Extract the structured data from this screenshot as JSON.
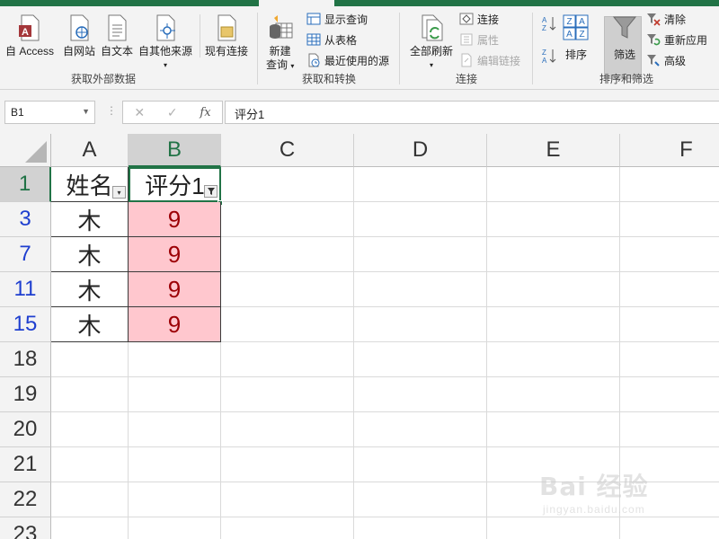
{
  "ribbon": {
    "groups": {
      "external": {
        "label": "获取外部数据",
        "buttons": [
          "自 Access",
          "自网站",
          "自文本",
          "自其他来源",
          "现有连接"
        ]
      },
      "transform": {
        "label": "获取和转换",
        "new_query": "新建",
        "new_query_sub": "查询",
        "show_query": "显示查询",
        "from_table": "从表格",
        "recent_sources": "最近使用的源"
      },
      "connections": {
        "label": "连接",
        "refresh_all": "全部刷新",
        "connections": "连接",
        "properties": "属性",
        "edit_links": "编辑链接"
      },
      "sort_filter": {
        "label": "排序和筛选",
        "sort": "排序",
        "filter": "筛选",
        "clear": "清除",
        "reapply": "重新应用",
        "advanced": "高级"
      }
    }
  },
  "formula_bar": {
    "name_box": "B1",
    "dots": "⋮",
    "cancel": "✕",
    "enter": "✓",
    "fx": "fx",
    "content": "评分1"
  },
  "grid": {
    "columns": [
      "A",
      "B",
      "C",
      "D",
      "E",
      "F"
    ],
    "rows": [
      "1",
      "3",
      "7",
      "11",
      "15",
      "18",
      "19",
      "20",
      "21",
      "22",
      "23"
    ],
    "header": {
      "a": "姓名",
      "b": "评分1"
    },
    "data": [
      {
        "a": "木",
        "b": "9"
      },
      {
        "a": "木",
        "b": "9"
      },
      {
        "a": "木",
        "b": "9"
      },
      {
        "a": "木",
        "b": "9"
      }
    ]
  },
  "watermark": {
    "brand": "Bai 经验",
    "sub": "jingyan.baidu.com"
  },
  "colors": {
    "accent": "#217346",
    "highlight_fill": "#ffc7ce",
    "highlight_text": "#9c0006",
    "filtered_row": "#1f3fcf"
  }
}
